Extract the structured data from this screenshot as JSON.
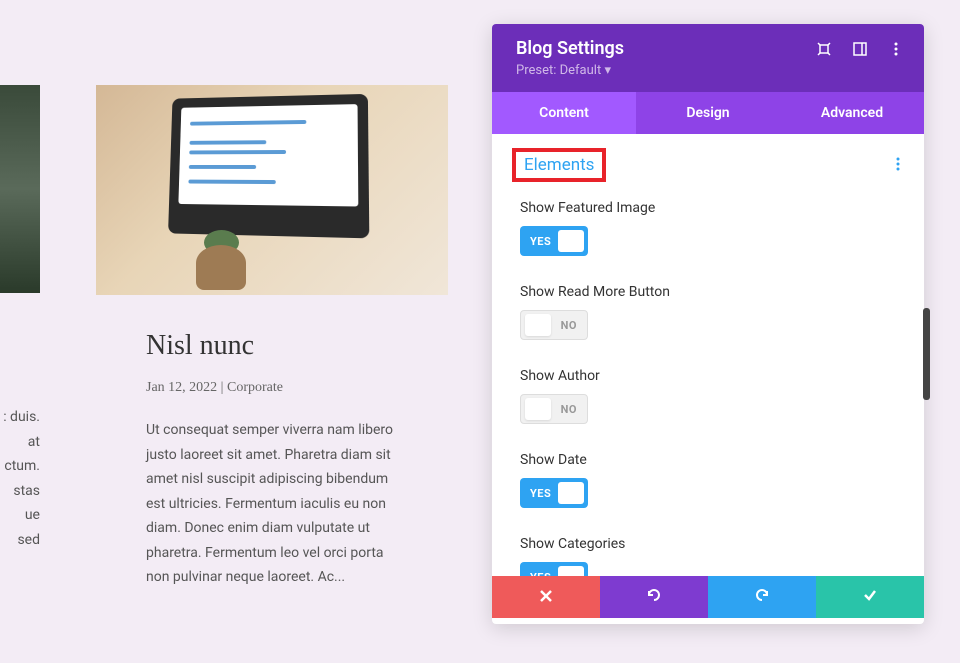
{
  "blog": {
    "title": "Nisl nunc",
    "date": "Jan 12, 2022",
    "separator": " | ",
    "category": "Corporate",
    "excerpt": "Ut consequat semper viverra nam libero justo laoreet sit amet. Pharetra diam sit amet nisl suscipit adipiscing bibendum est ultricies. Fermentum iaculis eu non diam. Donec enim diam vulputate ut pharetra. Fermentum leo vel orci porta non pulvinar neque laoreet. Ac..."
  },
  "leftEdge": {
    "line1": ": duis.",
    "line2": "at",
    "line3": "ctum.",
    "line4": "stas",
    "line5": "ue",
    "line6": "sed"
  },
  "panel": {
    "title": "Blog Settings",
    "preset_label": "Preset: ",
    "preset_value": "Default",
    "tabs": {
      "content": "Content",
      "design": "Design",
      "advanced": "Advanced"
    },
    "section_title": "Elements",
    "settings": [
      {
        "label": "Show Featured Image",
        "value": "YES",
        "on": true
      },
      {
        "label": "Show Read More Button",
        "value": "NO",
        "on": false
      },
      {
        "label": "Show Author",
        "value": "NO",
        "on": false
      },
      {
        "label": "Show Date",
        "value": "YES",
        "on": true
      },
      {
        "label": "Show Categories",
        "value": "YES",
        "on": true
      }
    ]
  }
}
